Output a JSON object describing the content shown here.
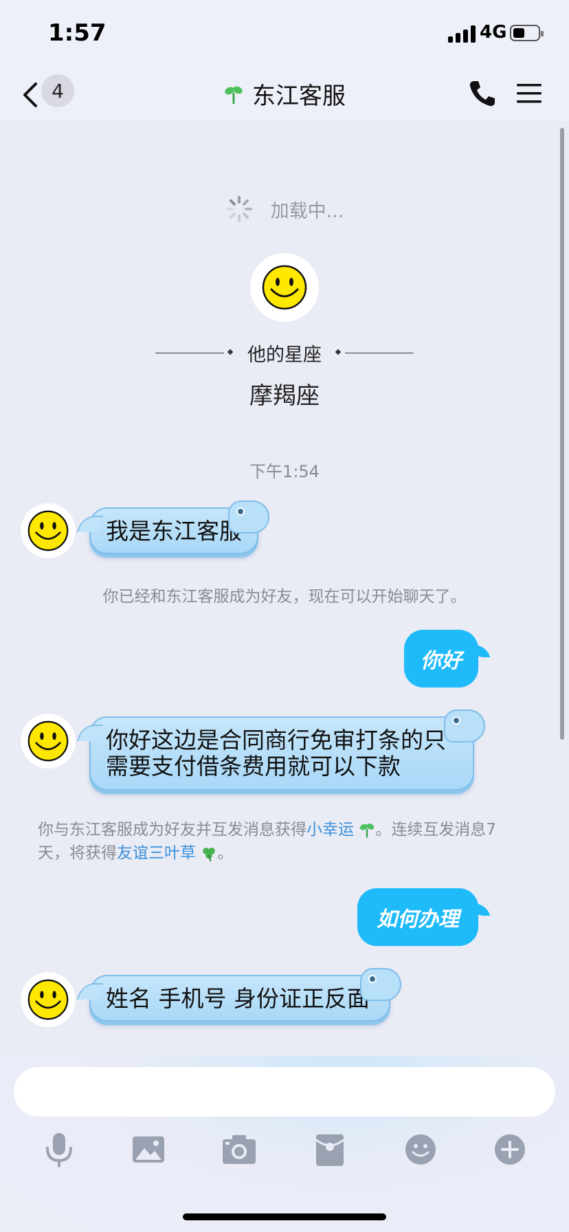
{
  "status_bar": {
    "time": "1:57",
    "network": "4G"
  },
  "nav": {
    "unread_count": "4",
    "title": "东江客服",
    "icons": {
      "back": "chevron-left-icon",
      "title_badge": "clover-sprout-icon",
      "call": "phone-icon",
      "menu": "hamburger-menu-icon"
    }
  },
  "chat": {
    "loading_text": "加载中...",
    "zodiac_label": "他的星座",
    "zodiac_value": "摩羯座",
    "timestamp": "下午1:54",
    "messages": [
      {
        "from": "them",
        "text": "我是东江客服"
      },
      {
        "from": "system",
        "text": "你已经和东江客服成为好友，现在可以开始聊天了。"
      },
      {
        "from": "me",
        "text": "你好"
      },
      {
        "from": "them",
        "text_line1": "你好这边是合同商行免审打条的只",
        "text_line2": "需要支付借条费用就可以下款"
      },
      {
        "from": "system",
        "part1": "你与东江客服成为好友并互发消息获得",
        "link1": "小幸运",
        "part2": "。连续互发消息7",
        "part3": "天，将获得",
        "link2": "友谊三叶草",
        "part4": "。"
      },
      {
        "from": "me",
        "text": "如何办理"
      },
      {
        "from": "them",
        "text": "姓名 手机号 身份证正反面"
      }
    ]
  },
  "input": {
    "placeholder": ""
  },
  "toolbar": {
    "icons": [
      "microphone-icon",
      "image-icon",
      "camera-icon",
      "red-packet-icon",
      "emoji-icon",
      "plus-icon"
    ]
  },
  "colors": {
    "outgoing_bubble": "#1ebafa",
    "incoming_bubble": "#b7def9",
    "link": "#3a8fd9",
    "background": "#e9ebf5"
  }
}
